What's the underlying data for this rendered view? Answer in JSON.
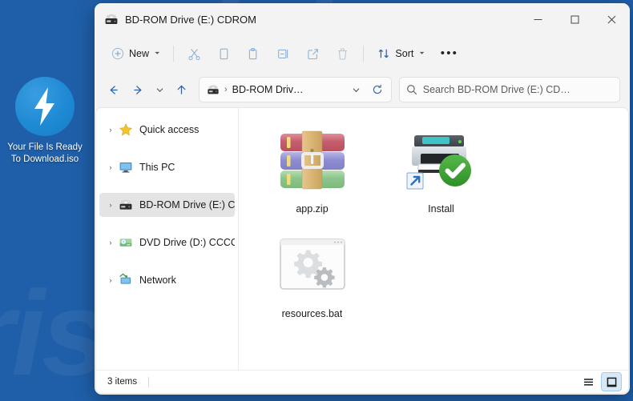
{
  "desktop": {
    "icon": {
      "name": "lightning-bolt-icon",
      "label": "Your File Is Ready To Download.iso",
      "circle_color": "#1e8ad4"
    },
    "background_color": "#1f5fa9",
    "watermark": "risk.com"
  },
  "window": {
    "title": "BD-ROM Drive (E:) CDROM",
    "title_icon": "bd-rom-drive-icon",
    "controls": {
      "minimize": "—",
      "maximize": "☐",
      "close": "✕"
    }
  },
  "toolbar": {
    "new_label": "New",
    "sort_label": "Sort",
    "more_label": "•••",
    "items": [
      {
        "name": "new-button",
        "label": "New"
      },
      {
        "name": "cut-button",
        "label": "Cut"
      },
      {
        "name": "copy-button",
        "label": "Copy"
      },
      {
        "name": "paste-button",
        "label": "Paste"
      },
      {
        "name": "rename-button",
        "label": "Rename"
      },
      {
        "name": "share-button",
        "label": "Share"
      },
      {
        "name": "delete-button",
        "label": "Delete"
      },
      {
        "name": "sort-button",
        "label": "Sort"
      },
      {
        "name": "see-more-button",
        "label": "See more"
      }
    ]
  },
  "addressbar": {
    "back": "←",
    "forward": "→",
    "recent": "˅",
    "up": "↑",
    "path_text": "BD-ROM Driv…",
    "path_separator": "›",
    "dropdown": "˅",
    "refresh": "⟳",
    "search_placeholder": "Search BD-ROM Drive (E:) CD…"
  },
  "sidebar": {
    "items": [
      {
        "label": "Quick access",
        "icon": "star-icon",
        "selected": false
      },
      {
        "label": "This PC",
        "icon": "monitor-icon",
        "selected": false
      },
      {
        "label": "BD-ROM Drive (E:) C",
        "icon": "bd-rom-drive-icon",
        "selected": true
      },
      {
        "label": "DVD Drive (D:) CCCC",
        "icon": "dvd-drive-icon",
        "selected": false
      },
      {
        "label": "Network",
        "icon": "network-icon",
        "selected": false
      }
    ],
    "chevron": "›"
  },
  "files": [
    {
      "label": "app.zip",
      "icon": "winrar-archive-icon"
    },
    {
      "label": "Install",
      "icon": "printer-shortcut-verified-icon"
    },
    {
      "label": "resources.bat",
      "icon": "batch-script-gears-icon"
    }
  ],
  "statusbar": {
    "item_count": "3 items",
    "list_view_label": "Details view",
    "grid_view_label": "Large icons view",
    "active_view": "grid"
  }
}
